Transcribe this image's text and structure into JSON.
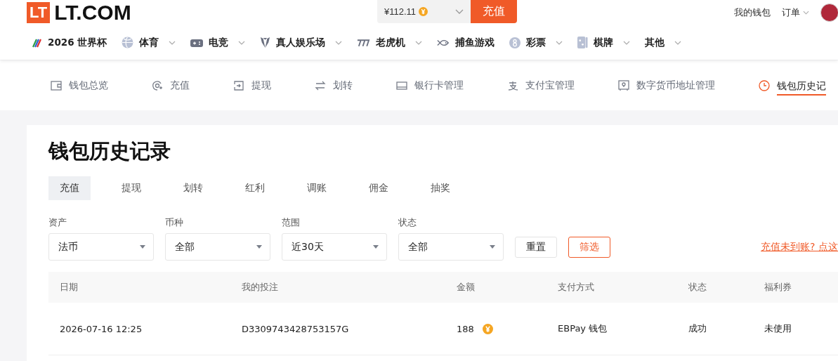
{
  "header": {
    "logo_mark": "LT",
    "logo_text": "LT.COM",
    "balance": "¥112.11",
    "recharge_button": "充值",
    "links": [
      {
        "label": "我的钱包",
        "dropdown": false
      },
      {
        "label": "订单",
        "dropdown": true
      }
    ]
  },
  "nav": [
    {
      "label": "2026 世界杯",
      "kind": "cup",
      "dropdown": false
    },
    {
      "label": "体育",
      "kind": "ball",
      "dropdown": true
    },
    {
      "label": "电竞",
      "kind": "gamepad",
      "dropdown": true
    },
    {
      "label": "真人娱乐场",
      "kind": "tuxedo",
      "dropdown": true
    },
    {
      "label": "老虎机",
      "kind": "slot",
      "dropdown": true
    },
    {
      "label": "捕鱼游戏",
      "kind": "fish",
      "dropdown": false
    },
    {
      "label": "彩票",
      "kind": "lottery",
      "dropdown": true
    },
    {
      "label": "棋牌",
      "kind": "dice",
      "dropdown": true
    },
    {
      "label": "其他",
      "kind": "plain",
      "dropdown": true
    }
  ],
  "wallet_nav": [
    {
      "label": "钱包总览",
      "kind": "wallet",
      "selected": false
    },
    {
      "label": "充值",
      "kind": "deposit",
      "selected": false
    },
    {
      "label": "提现",
      "kind": "withdraw",
      "selected": false
    },
    {
      "label": "划转",
      "kind": "transfer",
      "selected": false
    },
    {
      "label": "银行卡管理",
      "kind": "card",
      "selected": false
    },
    {
      "label": "支付宝管理",
      "kind": "alipay",
      "selected": false
    },
    {
      "label": "数字货币地址管理",
      "kind": "safe",
      "selected": false
    },
    {
      "label": "钱包历史记",
      "kind": "clock",
      "selected": true
    }
  ],
  "page_title": "钱包历史记录",
  "tabs": [
    {
      "label": "充值",
      "selected": true
    },
    {
      "label": "提现",
      "selected": false
    },
    {
      "label": "划转",
      "selected": false
    },
    {
      "label": "红利",
      "selected": false
    },
    {
      "label": "调账",
      "selected": false
    },
    {
      "label": "佣金",
      "selected": false
    },
    {
      "label": "抽奖",
      "selected": false
    }
  ],
  "filters": [
    {
      "label": "资产",
      "value": "法币"
    },
    {
      "label": "币种",
      "value": "全部"
    },
    {
      "label": "范围",
      "value": "近30天"
    },
    {
      "label": "状态",
      "value": "全部"
    }
  ],
  "buttons": [
    {
      "label": "重置",
      "kind": "plain"
    },
    {
      "label": "筛选",
      "kind": "primary"
    }
  ],
  "help_link": "充值未到账? 点这",
  "table": {
    "columns": [
      "日期",
      "我的投注",
      "金额",
      "支付方式",
      "状态",
      "福利券"
    ],
    "rows": [
      {
        "cells": [
          "2026-07-16 12:25",
          "D3309743428753157G",
          "188",
          "EBPay 钱包",
          "成功",
          "未使用"
        ]
      }
    ]
  }
}
